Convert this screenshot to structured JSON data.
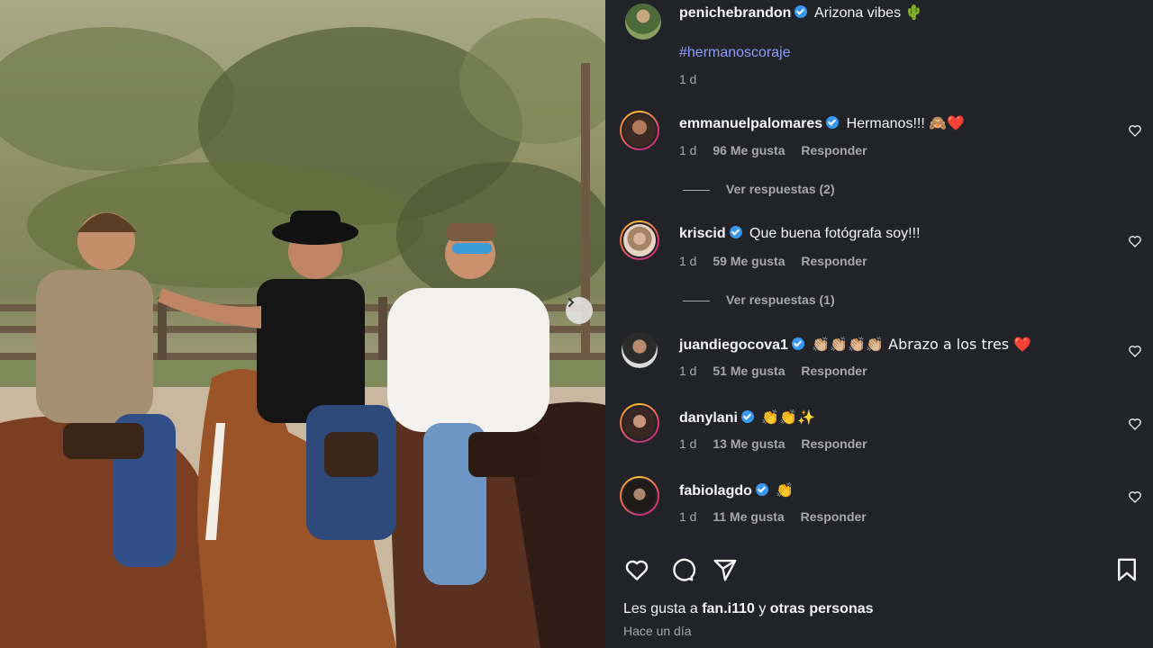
{
  "post": {
    "author": "penichebrandon",
    "caption": "Arizona vibes 🌵",
    "hashtag": "#hermanoscoraje",
    "time": "1 d"
  },
  "comments": [
    {
      "user": "emmanuelpalomares",
      "verified": true,
      "text": "Hermanos!!! 🙈❤️",
      "time": "1 d",
      "likes": "96 Me gusta",
      "reply": "Responder",
      "view_replies": "Ver respuestas (2)"
    },
    {
      "user": "kriscid",
      "verified": true,
      "text": "Que buena fotógrafa soy!!!",
      "time": "1 d",
      "likes": "59 Me gusta",
      "reply": "Responder",
      "view_replies": "Ver respuestas (1)"
    },
    {
      "user": "juandiegocova1",
      "verified": true,
      "text": "👏🏼👏🏼👏🏼👏🏼 Abrazo a los tres ❤️",
      "time": "1 d",
      "likes": "51 Me gusta",
      "reply": "Responder"
    },
    {
      "user": "danylani",
      "verified": true,
      "text": "👏👏✨",
      "time": "1 d",
      "likes": "13 Me gusta",
      "reply": "Responder"
    },
    {
      "user": "fabiolagdo",
      "verified": true,
      "text": "👏",
      "time": "1 d",
      "likes": "11 Me gusta",
      "reply": "Responder"
    }
  ],
  "footer": {
    "likes_prefix": "Les gusta a",
    "liker": "fan.i110",
    "likes_mid": "y",
    "others": "otras personas",
    "ago": "Hace un día"
  },
  "icons": [
    "heart-icon",
    "comment-icon",
    "share-icon",
    "bookmark-icon",
    "chevron-right-icon",
    "verified-icon"
  ],
  "colors": {
    "panel_bg": "#212328",
    "link": "#8c9cff",
    "verified": "#3897f0",
    "muted": "#a8a8a8"
  }
}
